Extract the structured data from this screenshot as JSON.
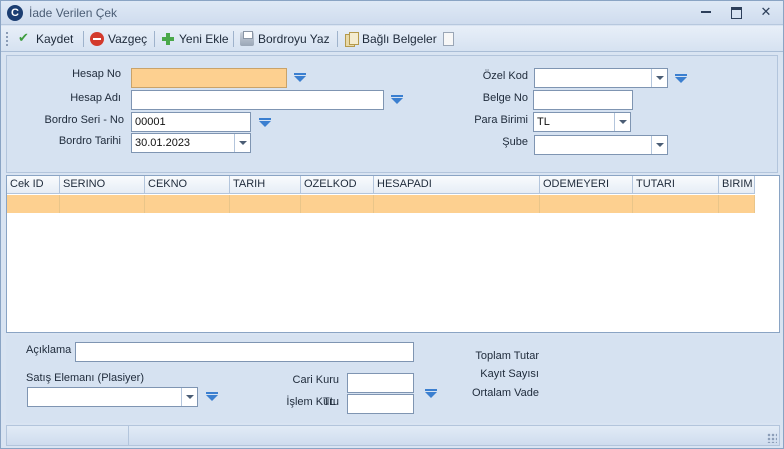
{
  "window": {
    "icon_letter": "C",
    "title": "İade Verilen Çek",
    "close_glyph": "✕"
  },
  "toolbar": {
    "save": "Kaydet",
    "cancel": "Vazgeç",
    "new": "Yeni Ekle",
    "print": "Bordroyu Yaz",
    "docs": "Bağlı Belgeler"
  },
  "form": {
    "hesap_no": {
      "label": "Hesap No",
      "value": ""
    },
    "hesap_adi": {
      "label": "Hesap Adı",
      "value": ""
    },
    "bordro_seri_no": {
      "label": "Bordro Seri - No",
      "value": "00001"
    },
    "bordro_tarihi": {
      "label": "Bordro Tarihi",
      "value": "30.01.2023"
    },
    "ozel_kod": {
      "label": "Özel Kod",
      "value": ""
    },
    "belge_no": {
      "label": "Belge No",
      "value": ""
    },
    "para_birimi": {
      "label": "Para Birimi",
      "value": "TL"
    },
    "sube": {
      "label": "Şube",
      "value": ""
    }
  },
  "grid": {
    "columns": [
      "Cek ID",
      "SERINO",
      "CEKNO",
      "TARIH",
      "OZELKOD",
      "HESAPADI",
      "ODEMEYERI",
      "TUTARI",
      "BIRIM"
    ],
    "rows": [
      [
        "",
        "",
        "",
        "",
        "",
        "",
        "",
        "",
        ""
      ]
    ]
  },
  "bottom": {
    "aciklama": {
      "label": "Açıklama",
      "value": ""
    },
    "satis_elemani": {
      "label": "Satış Elemanı (Plasiyer)",
      "value": ""
    },
    "cari_kuru": {
      "label": "Cari Kuru",
      "value": ""
    },
    "islem_kuru": {
      "label": "İşlem Kuru",
      "currency": "TL",
      "value": ""
    },
    "toplam_tutar": "Toplam Tutar",
    "kayit_sayisi": "Kayıt Sayısı",
    "ortalam_vade": "Ortalam Vade"
  },
  "colors": {
    "highlight": "#fdd090",
    "panel": "#d6e2f1",
    "picker_arrow": "#3b7fd0"
  }
}
